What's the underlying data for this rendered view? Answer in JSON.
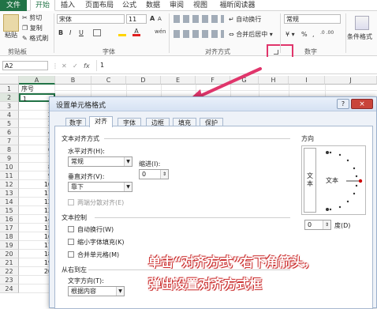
{
  "ribbon": {
    "tabs": [
      "文件",
      "开始",
      "插入",
      "页面布局",
      "公式",
      "数据",
      "审阅",
      "视图",
      "福昕阅读器"
    ],
    "clipboard": {
      "cut": "剪切",
      "copy": "复制",
      "format_painter": "格式刷",
      "paste": "粘贴",
      "label": "剪贴板"
    },
    "font": {
      "name": "宋体",
      "size": "11",
      "label": "字体",
      "bold": "B",
      "italic": "I",
      "underline": "U",
      "grow": "A",
      "shrink": "A"
    },
    "alignment": {
      "wrap": "自动换行",
      "merge": "合并后居中",
      "label": "对齐方式"
    },
    "number": {
      "format": "常规",
      "percent": "%",
      "comma": ",",
      "label": "数字"
    },
    "styles": {
      "conditional": "条件格式"
    }
  },
  "formula_bar": {
    "name_box": "A2",
    "fx": "fx",
    "value": "1"
  },
  "sheet": {
    "columns": [
      "A",
      "B",
      "C",
      "D",
      "E",
      "F",
      "G",
      "H",
      "I",
      "J"
    ],
    "rows": [
      "1",
      "2",
      "3",
      "4",
      "5",
      "6",
      "7",
      "8",
      "9",
      "10",
      "11",
      "12",
      "13",
      "14",
      "15",
      "16",
      "17",
      "18",
      "19",
      "20",
      "21",
      "22",
      "23",
      "24"
    ],
    "a1": "序号",
    "a2": "1",
    "values": [
      "1",
      "2",
      "3",
      "4",
      "5",
      "6",
      "7",
      "8",
      "9",
      "10",
      "11",
      "12",
      "13",
      "14",
      "15",
      "16",
      "17",
      "18",
      "19",
      "20"
    ]
  },
  "dialog": {
    "title": "设置单元格格式",
    "tabs": [
      "数字",
      "对齐",
      "字体",
      "边框",
      "填充",
      "保护"
    ],
    "active_tab": "对齐",
    "text_align_section": "文本对齐方式",
    "horizontal_label": "水平对齐(H):",
    "horizontal_value": "常规",
    "indent_label": "缩进(I):",
    "indent_value": "0",
    "vertical_label": "垂直对齐(V):",
    "vertical_value": "靠下",
    "justify_distributed": "两端分散对齐(E)",
    "text_control_section": "文本控制",
    "wrap_text": "自动换行(W)",
    "shrink_to_fit": "缩小字体填充(K)",
    "merge_cells": "合并单元格(M)",
    "rtl_section": "从右到左",
    "direction_label": "文字方向(T):",
    "direction_value": "根据内容",
    "orientation_section": "方向",
    "orientation_text_vertical": "文本",
    "orientation_text": "文本",
    "degree_value": "0",
    "degree_label": "度(D)",
    "help": "?",
    "close": "×"
  },
  "annotation": {
    "line1": "单击“对齐方式”右下角箭头，",
    "line2": "弹出设置对齐方式框",
    "color": "#e0356b"
  }
}
